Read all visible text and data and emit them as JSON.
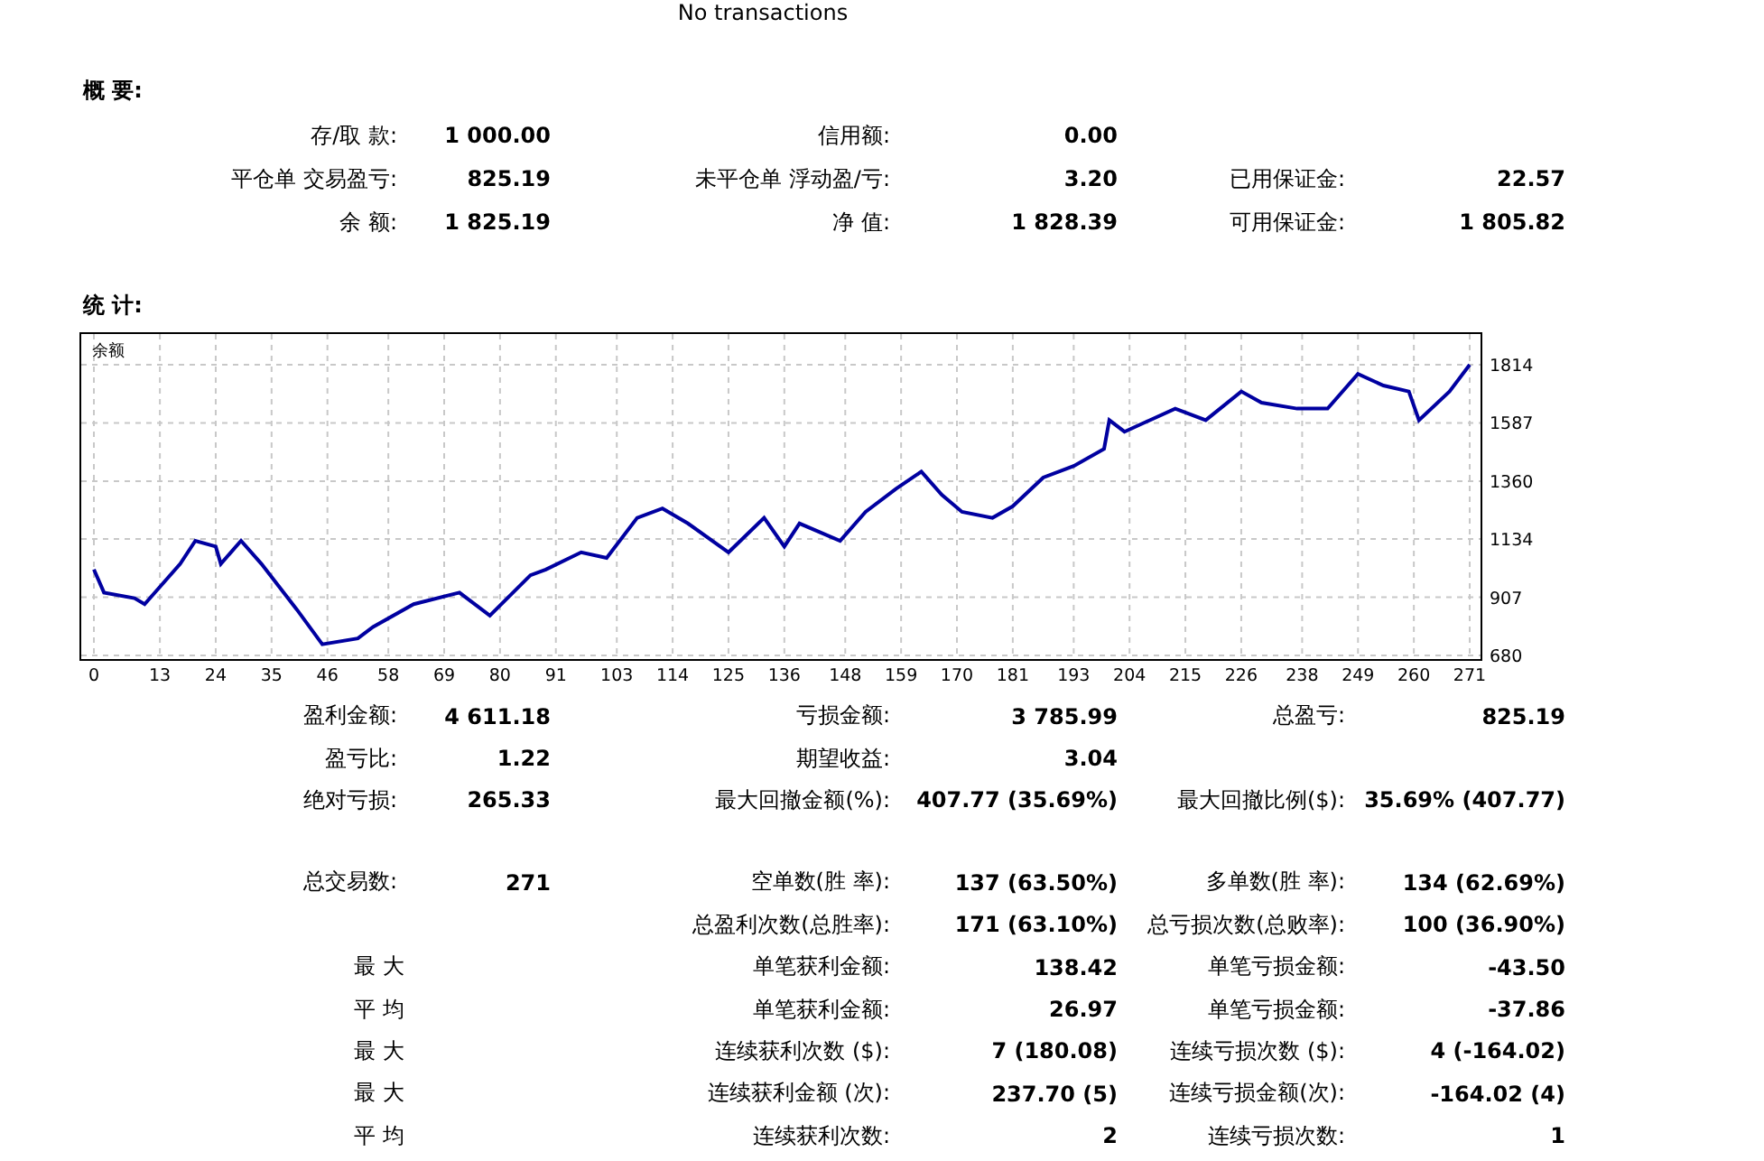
{
  "header": {
    "text": "No transactions"
  },
  "summary": {
    "title": "概 要:",
    "rows": [
      [
        {
          "label": "存/取 款:",
          "value": "1 000.00"
        },
        {
          "label": "信用额:",
          "value": "0.00"
        }
      ],
      [
        {
          "label": "平仓单 交易盈亏:",
          "value": "825.19"
        },
        {
          "label": "未平仓单 浮动盈/亏:",
          "value": "3.20"
        },
        {
          "label": "已用保证金:",
          "value": "22.57"
        }
      ],
      [
        {
          "label": "余 额:",
          "value": "1 825.19"
        },
        {
          "label": "净 值:",
          "value": "1 828.39"
        },
        {
          "label": "可用保证金:",
          "value": "1 805.82"
        }
      ]
    ]
  },
  "statistics": {
    "title": "统 计:",
    "chart_data": {
      "type": "line",
      "grid": true,
      "ylim": [
        680,
        1814
      ],
      "xlim": [
        0,
        271
      ],
      "yticks": [
        680,
        907,
        1134,
        1360,
        1587,
        1814
      ],
      "xticks": [
        0,
        13,
        24,
        35,
        46,
        58,
        69,
        80,
        91,
        103,
        114,
        125,
        136,
        148,
        159,
        170,
        181,
        193,
        204,
        215,
        226,
        238,
        249,
        260,
        271
      ],
      "x": [
        0,
        2,
        8,
        10,
        17,
        20,
        24,
        25,
        29,
        33,
        40,
        45,
        52,
        55,
        63,
        72,
        78,
        86,
        89,
        96,
        101,
        107,
        112,
        117,
        125,
        132,
        136,
        139,
        147,
        152,
        158,
        163,
        167,
        171,
        177,
        181,
        187,
        193,
        199,
        200,
        203,
        213,
        219,
        226,
        230,
        237,
        243,
        249,
        254,
        259,
        261,
        267,
        271
      ],
      "series": [
        {
          "name": "余额",
          "color": "#0000a0",
          "values": [
            1015,
            925,
            903,
            880,
            1037,
            1127,
            1105,
            1037,
            1127,
            1037,
            858,
            724,
            746,
            791,
            880,
            925,
            836,
            993,
            1015,
            1082,
            1060,
            1217,
            1253,
            1195,
            1082,
            1217,
            1105,
            1195,
            1127,
            1240,
            1330,
            1397,
            1307,
            1240,
            1217,
            1262,
            1374,
            1419,
            1486,
            1598,
            1553,
            1643,
            1598,
            1710,
            1666,
            1643,
            1643,
            1778,
            1733,
            1710,
            1598,
            1710,
            1814
          ]
        }
      ]
    },
    "blocks": [
      [
        {
          "col_1": {
            "label": "盈利金额:",
            "value": "4 611.18"
          },
          "col_2": {
            "label": "亏损金额:",
            "value": "3 785.99"
          },
          "col_3": {
            "label": "总盈亏:",
            "value": "825.19"
          }
        },
        {
          "col_1": {
            "label": "盈亏比:",
            "value": "1.22"
          },
          "col_2": {
            "label": "期望收益:",
            "value": "3.04"
          }
        },
        {
          "col_1": {
            "label": "绝对亏损:",
            "value": "265.33"
          },
          "col_2": {
            "label": "最大回撤金额(%):",
            "value": "407.77 (35.69%)"
          },
          "col_3": {
            "label": "最大回撤比例($):",
            "value": "35.69% (407.77)"
          }
        }
      ],
      [
        {
          "col_1": {
            "label": "总交易数:",
            "value": "271"
          },
          "col_2": {
            "label": "空单数(胜 率):",
            "value": "137 (63.50%)"
          },
          "col_3": {
            "label": "多单数(胜 率):",
            "value": "134 (62.69%)"
          }
        },
        {
          "col_2": {
            "label": "总盈利次数(总胜率):",
            "value": "171 (63.10%)"
          },
          "col_3": {
            "label": "总亏损次数(总败率):",
            "value": "100 (36.90%)"
          }
        },
        {
          "col_1": {
            "label": "最 大"
          },
          "col_2": {
            "label": "单笔获利金额:",
            "value": "138.42"
          },
          "col_3": {
            "label": "单笔亏损金额:",
            "value": "-43.50"
          }
        },
        {
          "col_1": {
            "label": "平 均"
          },
          "col_2": {
            "label": "单笔获利金额:",
            "value": "26.97"
          },
          "col_3": {
            "label": "单笔亏损金额:",
            "value": "-37.86"
          }
        },
        {
          "col_1": {
            "label": "最 大"
          },
          "col_2": {
            "label": "连续获利次数 ($):",
            "value": "7 (180.08)"
          },
          "col_3": {
            "label": "连续亏损次数 ($):",
            "value": "4 (-164.02)"
          }
        },
        {
          "col_1": {
            "label": "最 大"
          },
          "col_2": {
            "label": "连续获利金额 (次):",
            "value": "237.70 (5)"
          },
          "col_3": {
            "label": "连续亏损金额(次):",
            "value": "-164.02 (4)"
          }
        },
        {
          "col_1": {
            "label": "平 均"
          },
          "col_2": {
            "label": "连续获利次数:",
            "value": "2"
          },
          "col_3": {
            "label": "连续亏损次数:",
            "value": "1"
          }
        }
      ]
    ]
  }
}
